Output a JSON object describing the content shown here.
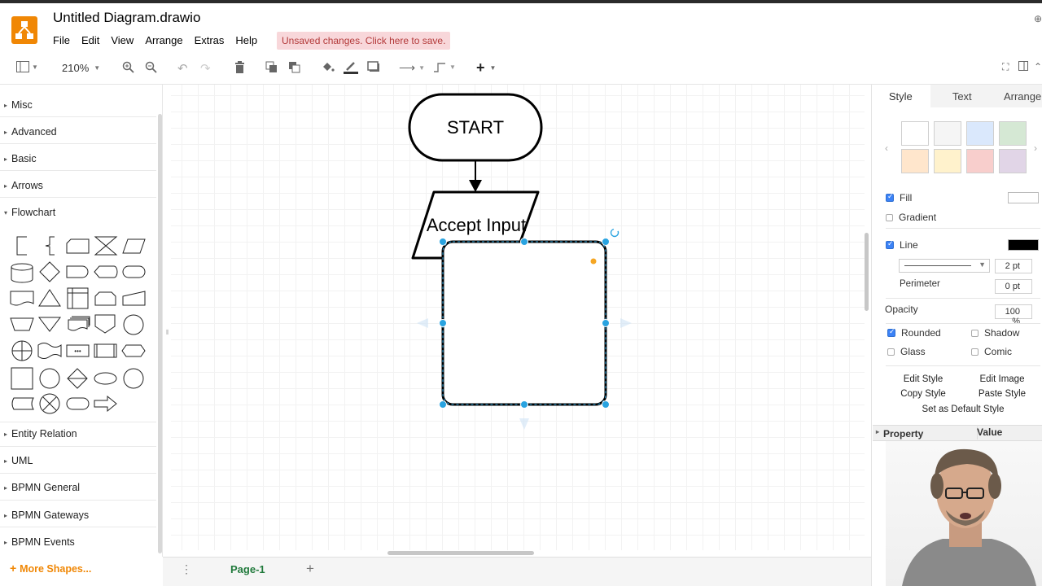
{
  "header": {
    "title": "Untitled Diagram.drawio",
    "menus": [
      "File",
      "Edit",
      "View",
      "Arrange",
      "Extras",
      "Help"
    ],
    "unsaved_banner": "Unsaved changes. Click here to save."
  },
  "toolbar": {
    "zoom": "210%"
  },
  "sidebar": {
    "sections_top": [
      "Misc",
      "Advanced",
      "Basic",
      "Arrows"
    ],
    "flowchart_label": "Flowchart",
    "sections_bottom": [
      "Entity Relation",
      "UML",
      "BPMN General",
      "BPMN Gateways",
      "BPMN Events"
    ],
    "more_shapes": "More Shapes..."
  },
  "canvas": {
    "start_label": "START",
    "input_label": "Accept Input"
  },
  "footer": {
    "page_tab": "Page-1"
  },
  "panel": {
    "tabs": [
      "Style",
      "Text",
      "Arrange"
    ],
    "swatch_colors": [
      "#ffffff",
      "#f5f5f5",
      "#dae8fc",
      "#d5e8d4",
      "#ffe6cc",
      "#fff2cc",
      "#f8cecc",
      "#e1d5e7"
    ],
    "fill_label": "Fill",
    "gradient_label": "Gradient",
    "line_label": "Line",
    "line_width": "2 pt",
    "perimeter_label": "Perimeter",
    "perimeter_value": "0 pt",
    "opacity_label": "Opacity",
    "opacity_value": "100 %",
    "rounded_label": "Rounded",
    "shadow_label": "Shadow",
    "glass_label": "Glass",
    "comic_label": "Comic",
    "edit_style": "Edit Style",
    "edit_image": "Edit Image",
    "copy_style": "Copy Style",
    "paste_style": "Paste Style",
    "set_default": "Set as Default Style",
    "property_header": "Property",
    "value_header": "Value"
  },
  "colors": {
    "logo": "#f08705",
    "accent": "#29a3e0",
    "unsaved_bg": "#f8d7da",
    "unsaved_text": "#b33a3a",
    "page_tab": "#217a3c"
  }
}
